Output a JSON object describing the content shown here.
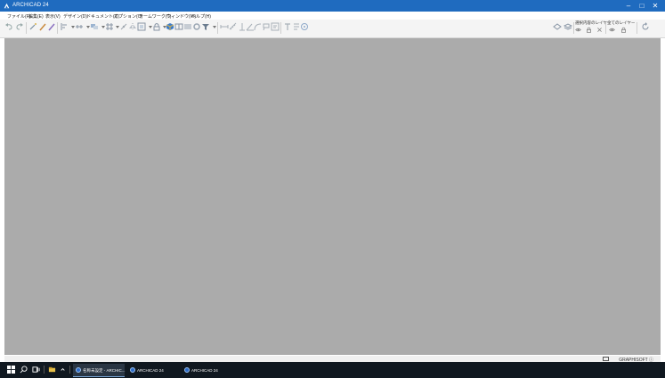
{
  "window": {
    "title": "ARCHICAD 24",
    "minimize": "–",
    "maximize": "□",
    "close": "✕"
  },
  "menu": [
    "ファイル(F)",
    "編集(E)",
    "表示(V)",
    "デザイン(D)",
    "ドキュメント(C)",
    "オプション(O)",
    "チームワーク(T)",
    "ウィンドウ(W)",
    "ヘルプ(H)"
  ],
  "toolbar": {
    "layer_label_1": "選択内容のレイヤー",
    "layer_label_2": "全てのレイヤー"
  },
  "statusbar": {
    "brand": "GRAPHISOFT ⓘ"
  },
  "taskbar": {
    "tasks": [
      {
        "label": "名称未設定 - ARCHIC..."
      },
      {
        "label": "ARCHICAD 24"
      },
      {
        "label": "ARCHICAD 24"
      }
    ]
  },
  "colors": {
    "titlebar": "#1f6bbf",
    "workspace": "#ababab",
    "taskbar": "#101820"
  }
}
